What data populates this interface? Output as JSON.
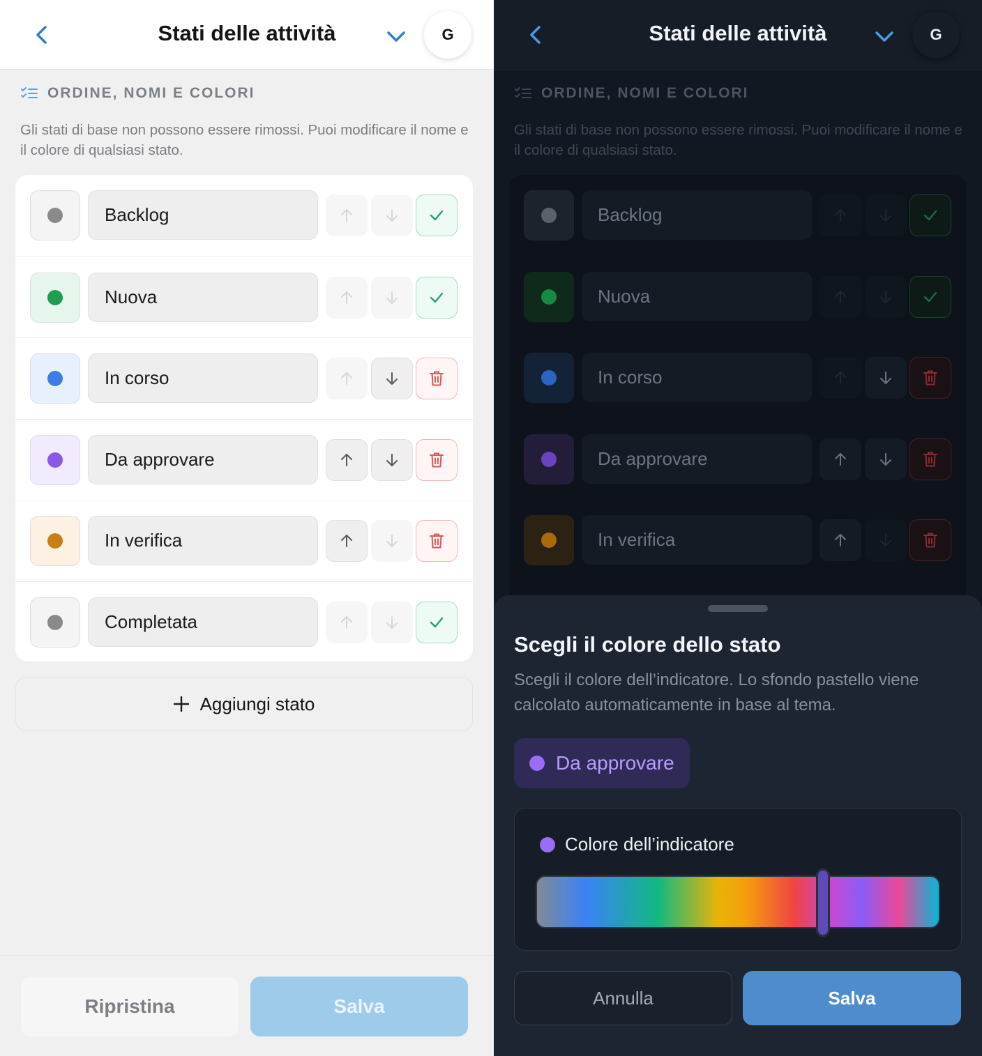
{
  "header": {
    "title": "Stati delle attività",
    "avatar_initial": "G"
  },
  "section": {
    "heading": "ORDINE, NOMI E COLORI",
    "description": "Gli stati di base non possono essere rimossi. Puoi modificare il nome e il colore di qualsiasi stato."
  },
  "statuses": [
    {
      "name": "Backlog",
      "dot": "#8a8a8a",
      "bg_light": "#f4f4f5",
      "bg_dark": "#1d232d",
      "dot_dark": "#5b616b",
      "up": false,
      "down": false,
      "action": "check"
    },
    {
      "name": "Nuova",
      "dot": "#1f9e4f",
      "bg_light": "#e6f6ec",
      "bg_dark": "#0f2a1b",
      "dot_dark": "#168a42",
      "up": false,
      "down": false,
      "action": "check"
    },
    {
      "name": "In corso",
      "dot": "#3b7ee8",
      "bg_light": "#e8f0fd",
      "bg_dark": "#142238",
      "dot_dark": "#2c64c2",
      "up": false,
      "down": true,
      "action": "delete"
    },
    {
      "name": "Da approvare",
      "dot": "#8b57e8",
      "bg_light": "#f1ebfd",
      "bg_dark": "#221d38",
      "dot_dark": "#6c43bd",
      "up": true,
      "down": true,
      "action": "delete"
    },
    {
      "name": "In verifica",
      "dot": "#c98013",
      "bg_light": "#fcf1e2",
      "bg_dark": "#2c2214",
      "dot_dark": "#a96a0e",
      "up": true,
      "down": false,
      "action": "delete"
    },
    {
      "name": "Completata",
      "dot": "#8a8a8a",
      "bg_light": "#f4f4f5",
      "up": false,
      "down": false,
      "action": "check"
    }
  ],
  "add_status_label": "Aggiungi stato",
  "footer": {
    "reset_label": "Ripristina",
    "save_label": "Salva"
  },
  "sheet": {
    "title": "Scegli il colore dello stato",
    "description": "Scegli il colore dell’indicatore. Lo sfondo pastello viene calcolato automaticamente in base al tema.",
    "preview_label": "Da approvare",
    "preview_dot": "#9b6cf5",
    "indicator_label": "Colore dell’indicatore",
    "hue_value": 0.71,
    "cancel_label": "Annulla",
    "save_label": "Salva"
  },
  "colors": {
    "accent": "#2a7fd1",
    "success": "#23a36a",
    "danger": "#e05454"
  }
}
